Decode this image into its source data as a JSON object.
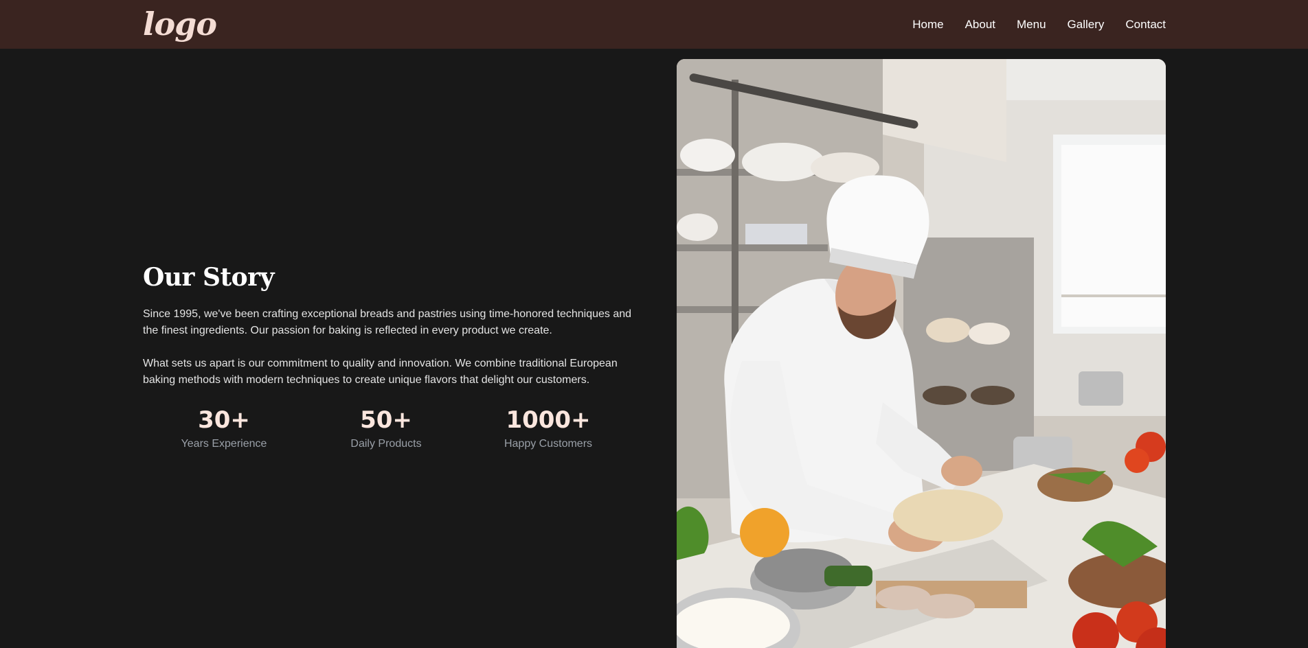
{
  "nav": {
    "logo": "logo",
    "links": [
      "Home",
      "About",
      "Menu",
      "Gallery",
      "Contact"
    ]
  },
  "story": {
    "title": "Our Story",
    "paragraphs": [
      "Since 1995, we've been crafting exceptional breads and pastries using time-honored techniques and the finest ingredients. Our passion for baking is reflected in every product we create.",
      "What sets us apart is our commitment to quality and innovation. We combine traditional European baking methods with modern techniques to create unique flavors that delight our customers."
    ],
    "stats": [
      {
        "value": "30+",
        "label": "Years Experience"
      },
      {
        "value": "50+",
        "label": "Daily Products"
      },
      {
        "value": "1000+",
        "label": "Happy Customers"
      }
    ]
  },
  "colors": {
    "nav_bg": "#3a2420",
    "page_bg": "#181818",
    "accent": "#fbe6de"
  }
}
